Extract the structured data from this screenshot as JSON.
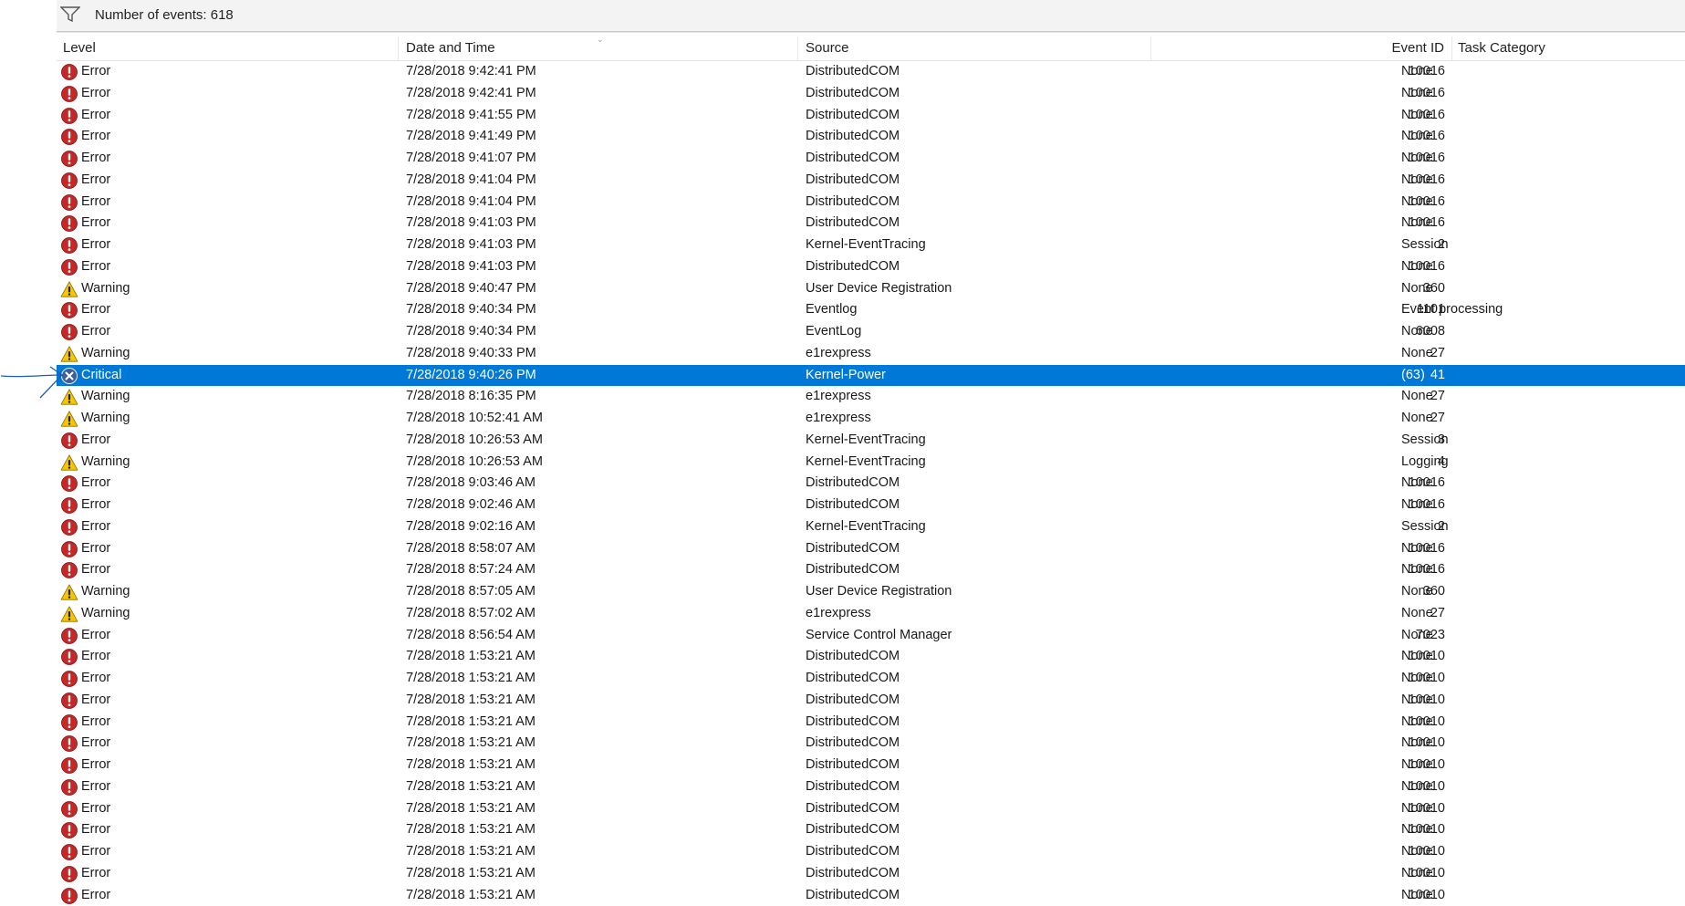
{
  "filter_bar": {
    "event_count_text": "Number of events: 618"
  },
  "columns": [
    {
      "key": "level",
      "label": "Level"
    },
    {
      "key": "date",
      "label": "Date and Time"
    },
    {
      "key": "source",
      "label": "Source"
    },
    {
      "key": "event_id",
      "label": "Event ID"
    },
    {
      "key": "task",
      "label": "Task Category"
    }
  ],
  "colors": {
    "selection": "#0078d7",
    "error_icon": "#c62828",
    "warning_icon": "#f6c600",
    "critical_icon": "#3d5f99",
    "annotation_arrow": "#1a5fb4"
  },
  "selected_index": 14,
  "events": [
    {
      "level": "Error",
      "date": "7/28/2018 9:42:41 PM",
      "source": "DistributedCOM",
      "event_id": "10016",
      "task": "None"
    },
    {
      "level": "Error",
      "date": "7/28/2018 9:42:41 PM",
      "source": "DistributedCOM",
      "event_id": "10016",
      "task": "None"
    },
    {
      "level": "Error",
      "date": "7/28/2018 9:41:55 PM",
      "source": "DistributedCOM",
      "event_id": "10016",
      "task": "None"
    },
    {
      "level": "Error",
      "date": "7/28/2018 9:41:49 PM",
      "source": "DistributedCOM",
      "event_id": "10016",
      "task": "None"
    },
    {
      "level": "Error",
      "date": "7/28/2018 9:41:07 PM",
      "source": "DistributedCOM",
      "event_id": "10016",
      "task": "None"
    },
    {
      "level": "Error",
      "date": "7/28/2018 9:41:04 PM",
      "source": "DistributedCOM",
      "event_id": "10016",
      "task": "None"
    },
    {
      "level": "Error",
      "date": "7/28/2018 9:41:04 PM",
      "source": "DistributedCOM",
      "event_id": "10016",
      "task": "None"
    },
    {
      "level": "Error",
      "date": "7/28/2018 9:41:03 PM",
      "source": "DistributedCOM",
      "event_id": "10016",
      "task": "None"
    },
    {
      "level": "Error",
      "date": "7/28/2018 9:41:03 PM",
      "source": "Kernel-EventTracing",
      "event_id": "2",
      "task": "Session"
    },
    {
      "level": "Error",
      "date": "7/28/2018 9:41:03 PM",
      "source": "DistributedCOM",
      "event_id": "10016",
      "task": "None"
    },
    {
      "level": "Warning",
      "date": "7/28/2018 9:40:47 PM",
      "source": "User Device Registration",
      "event_id": "360",
      "task": "None"
    },
    {
      "level": "Error",
      "date": "7/28/2018 9:40:34 PM",
      "source": "Eventlog",
      "event_id": "1101",
      "task": "Event processing"
    },
    {
      "level": "Error",
      "date": "7/28/2018 9:40:34 PM",
      "source": "EventLog",
      "event_id": "6008",
      "task": "None"
    },
    {
      "level": "Warning",
      "date": "7/28/2018 9:40:33 PM",
      "source": "e1rexpress",
      "event_id": "27",
      "task": "None"
    },
    {
      "level": "Critical",
      "date": "7/28/2018 9:40:26 PM",
      "source": "Kernel-Power",
      "event_id": "41",
      "task": "(63)"
    },
    {
      "level": "Warning",
      "date": "7/28/2018 8:16:35 PM",
      "source": "e1rexpress",
      "event_id": "27",
      "task": "None"
    },
    {
      "level": "Warning",
      "date": "7/28/2018 10:52:41 AM",
      "source": "e1rexpress",
      "event_id": "27",
      "task": "None"
    },
    {
      "level": "Error",
      "date": "7/28/2018 10:26:53 AM",
      "source": "Kernel-EventTracing",
      "event_id": "3",
      "task": "Session"
    },
    {
      "level": "Warning",
      "date": "7/28/2018 10:26:53 AM",
      "source": "Kernel-EventTracing",
      "event_id": "4",
      "task": "Logging"
    },
    {
      "level": "Error",
      "date": "7/28/2018 9:03:46 AM",
      "source": "DistributedCOM",
      "event_id": "10016",
      "task": "None"
    },
    {
      "level": "Error",
      "date": "7/28/2018 9:02:46 AM",
      "source": "DistributedCOM",
      "event_id": "10016",
      "task": "None"
    },
    {
      "level": "Error",
      "date": "7/28/2018 9:02:16 AM",
      "source": "Kernel-EventTracing",
      "event_id": "2",
      "task": "Session"
    },
    {
      "level": "Error",
      "date": "7/28/2018 8:58:07 AM",
      "source": "DistributedCOM",
      "event_id": "10016",
      "task": "None"
    },
    {
      "level": "Error",
      "date": "7/28/2018 8:57:24 AM",
      "source": "DistributedCOM",
      "event_id": "10016",
      "task": "None"
    },
    {
      "level": "Warning",
      "date": "7/28/2018 8:57:05 AM",
      "source": "User Device Registration",
      "event_id": "360",
      "task": "None"
    },
    {
      "level": "Warning",
      "date": "7/28/2018 8:57:02 AM",
      "source": "e1rexpress",
      "event_id": "27",
      "task": "None"
    },
    {
      "level": "Error",
      "date": "7/28/2018 8:56:54 AM",
      "source": "Service Control Manager",
      "event_id": "7023",
      "task": "None"
    },
    {
      "level": "Error",
      "date": "7/28/2018 1:53:21 AM",
      "source": "DistributedCOM",
      "event_id": "10010",
      "task": "None"
    },
    {
      "level": "Error",
      "date": "7/28/2018 1:53:21 AM",
      "source": "DistributedCOM",
      "event_id": "10010",
      "task": "None"
    },
    {
      "level": "Error",
      "date": "7/28/2018 1:53:21 AM",
      "source": "DistributedCOM",
      "event_id": "10010",
      "task": "None"
    },
    {
      "level": "Error",
      "date": "7/28/2018 1:53:21 AM",
      "source": "DistributedCOM",
      "event_id": "10010",
      "task": "None"
    },
    {
      "level": "Error",
      "date": "7/28/2018 1:53:21 AM",
      "source": "DistributedCOM",
      "event_id": "10010",
      "task": "None"
    },
    {
      "level": "Error",
      "date": "7/28/2018 1:53:21 AM",
      "source": "DistributedCOM",
      "event_id": "10010",
      "task": "None"
    },
    {
      "level": "Error",
      "date": "7/28/2018 1:53:21 AM",
      "source": "DistributedCOM",
      "event_id": "10010",
      "task": "None"
    },
    {
      "level": "Error",
      "date": "7/28/2018 1:53:21 AM",
      "source": "DistributedCOM",
      "event_id": "10010",
      "task": "None"
    },
    {
      "level": "Error",
      "date": "7/28/2018 1:53:21 AM",
      "source": "DistributedCOM",
      "event_id": "10010",
      "task": "None"
    },
    {
      "level": "Error",
      "date": "7/28/2018 1:53:21 AM",
      "source": "DistributedCOM",
      "event_id": "10010",
      "task": "None"
    },
    {
      "level": "Error",
      "date": "7/28/2018 1:53:21 AM",
      "source": "DistributedCOM",
      "event_id": "10010",
      "task": "None"
    },
    {
      "level": "Error",
      "date": "7/28/2018 1:53:21 AM",
      "source": "DistributedCOM",
      "event_id": "10010",
      "task": "None"
    }
  ]
}
